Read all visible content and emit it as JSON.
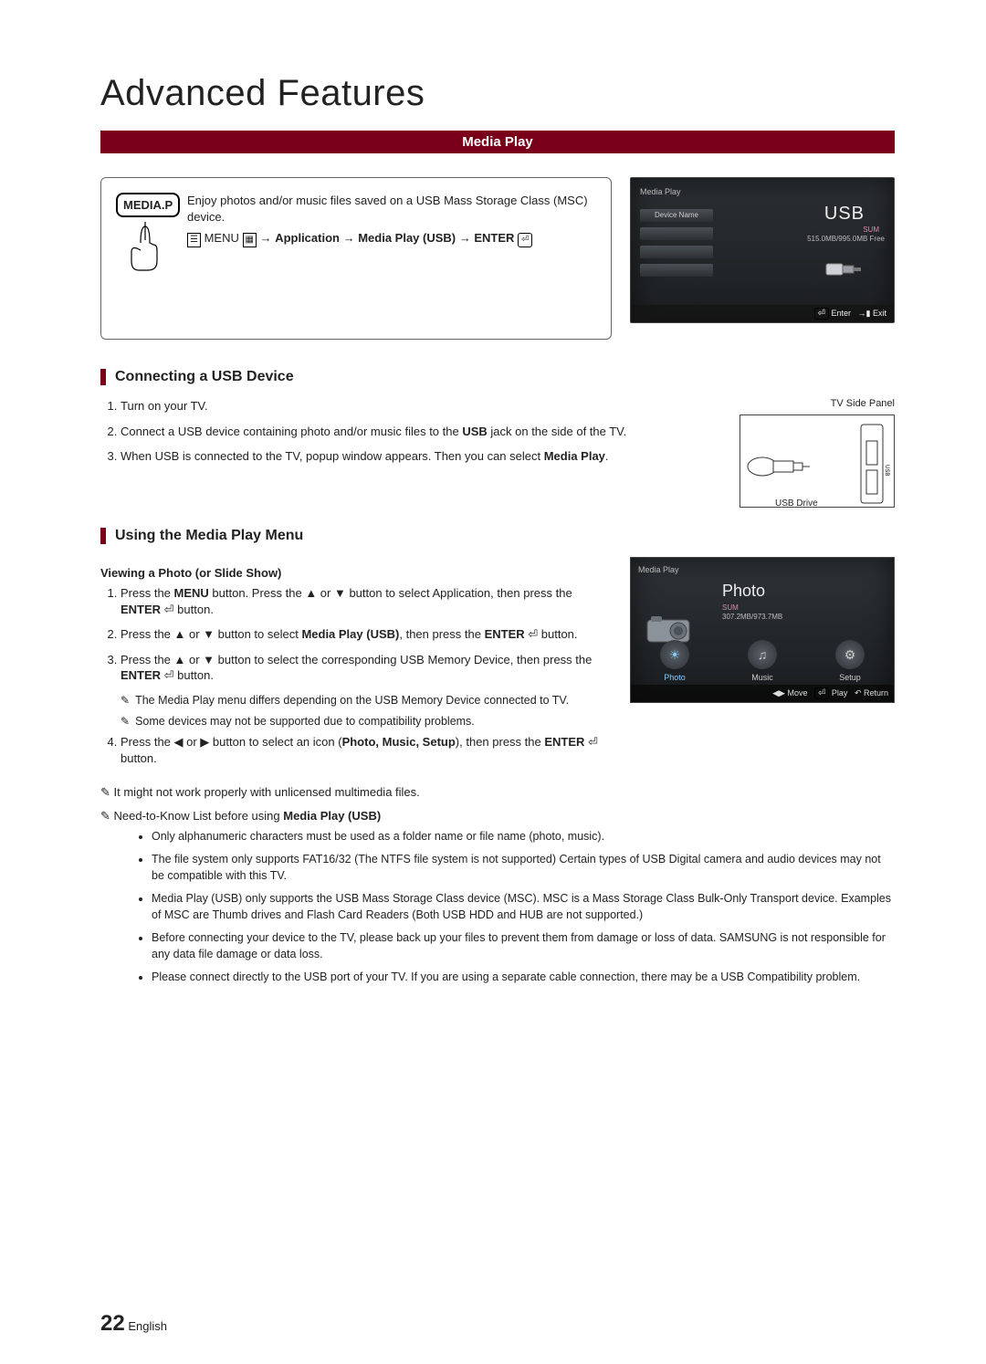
{
  "page": {
    "title": "Advanced Features",
    "section_bar": "Media Play",
    "page_number": "22",
    "language": "English"
  },
  "intro": {
    "button_label": "MEDIA.P",
    "description": "Enjoy photos and/or music files saved on a USB Mass Storage Class (MSC) device.",
    "path_prefix": "MENU",
    "path_app": "Application",
    "path_mediaplay": "Media Play (USB)",
    "path_enter": "ENTER"
  },
  "tv1": {
    "header": "Media Play",
    "slot_label": "Device Name",
    "usb_label": "USB",
    "sum": "SUM",
    "free": "515.0MB/995.0MB Free",
    "enter": "Enter",
    "exit": "Exit"
  },
  "connect": {
    "heading": "Connecting a USB Device",
    "side_label": "TV Side Panel",
    "usb_drive_label": "USB Drive",
    "steps": [
      "Turn on your TV.",
      "Connect a USB device containing photo and/or music files to the <b>USB</b> jack on the side of the TV.",
      "When USB is connected to the TV, popup window appears. Then you can select <b>Media Play</b>."
    ]
  },
  "using": {
    "heading": "Using the Media Play Menu",
    "subtitle": "Viewing a Photo (or Slide Show)",
    "steps": [
      "Press the <b>MENU</b> button. Press the ▲ or ▼ button to select Application, then press the <b>ENTER</b> ⏎ button.",
      "Press the ▲ or ▼ button to select <b>Media Play (USB)</b>, then press the <b>ENTER</b> ⏎ button.",
      "Press the ▲ or ▼ button to select the corresponding USB Memory Device, then press the <b>ENTER</b> ⏎ button.",
      "Press the ◀ or ▶ button to select an icon (<b>Photo, Music, Setup</b>), then press the <b>ENTER</b> ⏎ button."
    ],
    "sub_notes": [
      "The Media Play menu differs depending on the USB Memory Device connected to TV.",
      "Some devices may not be supported due to compatibility problems."
    ],
    "top_note1": "It might not work properly with unlicensed multimedia files.",
    "top_note2_prefix": "Need-to-Know List before using",
    "top_note2_bold": "Media Play (USB)",
    "bullets": [
      "Only alphanumeric characters must be used as a folder name or file name (photo, music).",
      "The file system only supports FAT16/32 (The NTFS file system is not supported) Certain types of USB Digital camera and audio devices may not be compatible with this TV.",
      "Media Play (USB) only supports the USB Mass Storage Class device (MSC). MSC is a Mass Storage Class Bulk-Only Transport device. Examples of MSC are Thumb drives and Flash Card Readers (Both USB HDD and HUB are not supported.)",
      "Before connecting your device to the TV, please back up your files to prevent them from damage or loss of data. SAMSUNG is not responsible for any data file damage or data loss.",
      "Please connect directly to the USB port of your TV. If you are using a separate cable connection, there may be a USB Compatibility problem."
    ]
  },
  "tv2": {
    "header": "Media Play",
    "title": "Photo",
    "sum": "SUM",
    "size": "307.2MB/973.7MB",
    "icons": {
      "photo": "Photo",
      "music": "Music",
      "setup": "Setup"
    },
    "move": "Move",
    "play": "Play",
    "return": "Return"
  }
}
